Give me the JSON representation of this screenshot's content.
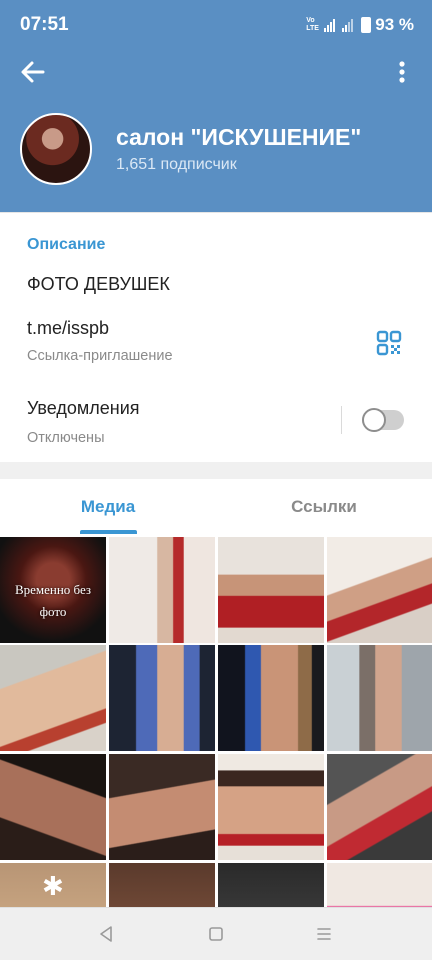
{
  "status_bar": {
    "time": "07:51",
    "network_label": "Vo LTE",
    "battery_percent": "93 %"
  },
  "header": {
    "channel_name": "салон \"ИСКУШЕНИЕ\"",
    "subscribers": "1,651 подписчик",
    "background_color": "#5a8fc3",
    "icons": {
      "back": "arrow-left-icon",
      "menu": "more-vertical-icon"
    }
  },
  "info": {
    "section_title": "Описание",
    "description": "ФОТО ДЕВУШЕК",
    "link": "t.me/isspb",
    "link_caption": "Ссылка-приглашение",
    "qr_icon": "qr-code-icon",
    "notifications_label": "Уведомления",
    "notifications_status": "Отключены",
    "notifications_enabled": false
  },
  "tabs": {
    "active": "media",
    "items": [
      {
        "id": "media",
        "label": "Медиа"
      },
      {
        "id": "links",
        "label": "Ссылки"
      }
    ],
    "accent_color": "#3a96d3"
  },
  "media_grid": {
    "cells": [
      {
        "caption": "Временно без фото"
      },
      {
        "caption": ""
      },
      {
        "caption": ""
      },
      {
        "caption": ""
      },
      {
        "caption": ""
      },
      {
        "caption": ""
      },
      {
        "caption": ""
      },
      {
        "caption": ""
      },
      {
        "caption": ""
      },
      {
        "caption": ""
      },
      {
        "caption": ""
      },
      {
        "caption": ""
      },
      {
        "caption": ""
      },
      {
        "caption": ""
      },
      {
        "caption": ""
      },
      {
        "caption": ""
      }
    ]
  },
  "nav_bar": {
    "icons": [
      "back-triangle-icon",
      "home-square-icon",
      "recents-icon"
    ]
  }
}
